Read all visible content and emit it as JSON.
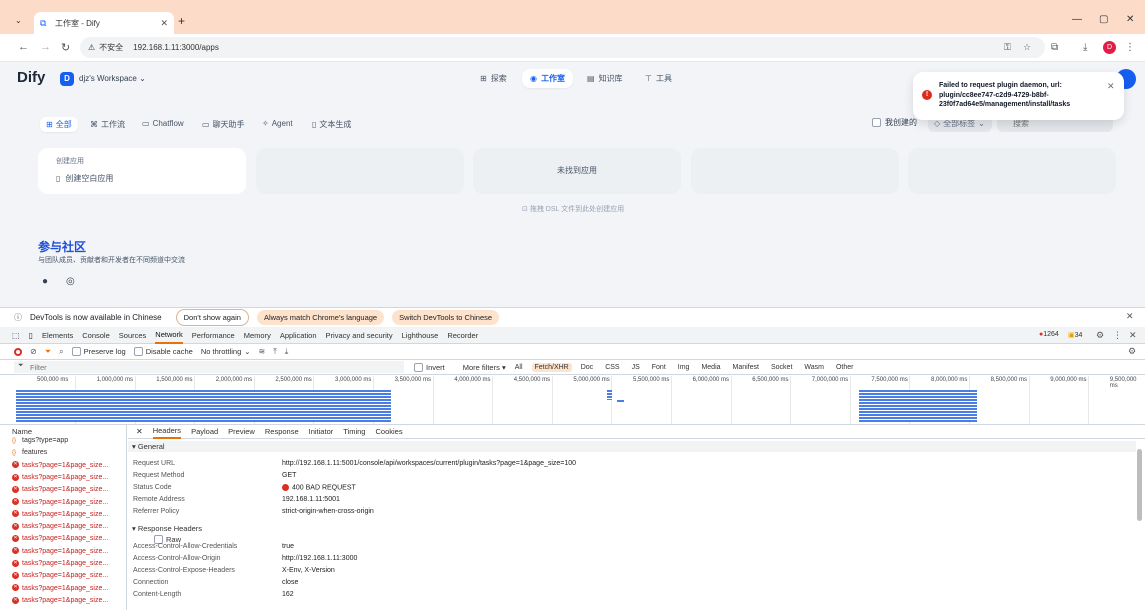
{
  "browser": {
    "tab_title": "工作室 - Dify",
    "url_warning": "不安全",
    "url": "192.168.1.11:3000/apps",
    "profile_initial": "D"
  },
  "app": {
    "logo": "Dify",
    "workspace_initial": "D",
    "workspace_name": "djz's Workspace",
    "nav": {
      "explore": "探索",
      "studio": "工作室",
      "knowledge": "知识库",
      "tools": "工具"
    },
    "filters": {
      "all": "全部",
      "workflow": "工作流",
      "chatflow": "Chatflow",
      "chatbot": "聊天助手",
      "agent": "Agent",
      "text_gen": "文本生成"
    },
    "my_created": "我创建的",
    "tag_filter": "全部标签",
    "search_placeholder": "搜索",
    "create_title": "创建应用",
    "create_blank": "创建空白应用",
    "not_found": "未找到应用",
    "dsl_hint": "拖拽 DSL 文件到此处创建应用",
    "community_title": "参与社区",
    "community_desc": "与团队成员、贡献者和开发者在不同频道中交流"
  },
  "toast": {
    "message": "Failed to request plugin daemon, url: plugin/cc8ee747-c2d9-4729-b8bf-23f0f7ad64e5/management/install/tasks"
  },
  "devtools": {
    "info_text": "DevTools is now available in Chinese",
    "btn_dont_show": "Don't show again",
    "btn_match": "Always match Chrome's language",
    "btn_switch": "Switch DevTools to Chinese",
    "tabs": [
      "Elements",
      "Console",
      "Sources",
      "Network",
      "Performance",
      "Memory",
      "Application",
      "Privacy and security",
      "Lighthouse",
      "Recorder"
    ],
    "error_count": "1264",
    "warn_count": "34",
    "preserve_log": "Preserve log",
    "disable_cache": "Disable cache",
    "throttling": "No throttling",
    "filter_placeholder": "Filter",
    "invert": "Invert",
    "more_filters": "More filters ▾",
    "types": [
      "All",
      "Fetch/XHR",
      "Doc",
      "CSS",
      "JS",
      "Font",
      "Img",
      "Media",
      "Manifest",
      "Socket",
      "Wasm",
      "Other"
    ],
    "ticks": [
      "500,000 ms",
      "1,000,000 ms",
      "1,500,000 ms",
      "2,000,000 ms",
      "2,500,000 ms",
      "3,000,000 ms",
      "3,500,000 ms",
      "4,000,000 ms",
      "4,500,000 ms",
      "5,000,000 ms",
      "5,500,000 ms",
      "6,000,000 ms",
      "6,500,000 ms",
      "7,000,000 ms",
      "7,500,000 ms",
      "8,000,000 ms",
      "8,500,000 ms",
      "9,000,000 ms",
      "9,500,000 ms"
    ],
    "name_header": "Name",
    "requests": [
      {
        "name": "tags?type=app",
        "error": false
      },
      {
        "name": "features",
        "error": false
      },
      {
        "name": "tasks?page=1&page_size...",
        "error": true
      },
      {
        "name": "tasks?page=1&page_size...",
        "error": true
      },
      {
        "name": "tasks?page=1&page_size...",
        "error": true
      },
      {
        "name": "tasks?page=1&page_size...",
        "error": true
      },
      {
        "name": "tasks?page=1&page_size...",
        "error": true
      },
      {
        "name": "tasks?page=1&page_size...",
        "error": true
      },
      {
        "name": "tasks?page=1&page_size...",
        "error": true
      },
      {
        "name": "tasks?page=1&page_size...",
        "error": true
      },
      {
        "name": "tasks?page=1&page_size...",
        "error": true
      },
      {
        "name": "tasks?page=1&page_size...",
        "error": true
      },
      {
        "name": "tasks?page=1&page_size...",
        "error": true
      },
      {
        "name": "tasks?page=1&page_size...",
        "error": true
      }
    ],
    "detail_tabs": [
      "Headers",
      "Payload",
      "Preview",
      "Response",
      "Initiator",
      "Timing",
      "Cookies"
    ],
    "general_label": "▾ General",
    "general": [
      {
        "k": "Request URL",
        "v": "http://192.168.1.11:5001/console/api/workspaces/current/plugin/tasks?page=1&page_size=100"
      },
      {
        "k": "Request Method",
        "v": "GET"
      },
      {
        "k": "Status Code",
        "v": "400 BAD REQUEST"
      },
      {
        "k": "Remote Address",
        "v": "192.168.1.11:5001"
      },
      {
        "k": "Referrer Policy",
        "v": "strict-origin-when-cross-origin"
      }
    ],
    "response_headers_label": "▾ Response Headers",
    "raw_label": "Raw",
    "response_headers": [
      {
        "k": "Access-Control-Allow-Credentials",
        "v": "true"
      },
      {
        "k": "Access-Control-Allow-Origin",
        "v": "http://192.168.1.11:3000"
      },
      {
        "k": "Access-Control-Expose-Headers",
        "v": "X-Env, X-Version"
      },
      {
        "k": "Connection",
        "v": "close"
      },
      {
        "k": "Content-Length",
        "v": "162"
      }
    ]
  }
}
